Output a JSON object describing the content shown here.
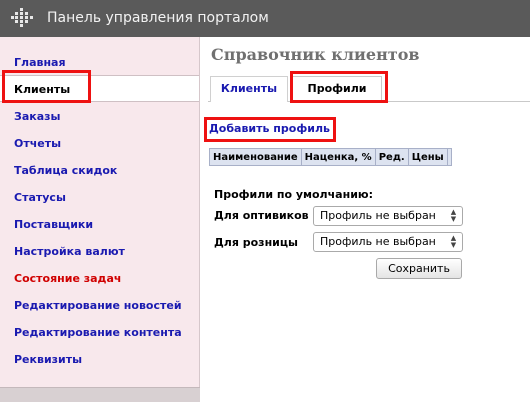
{
  "header": {
    "title": "Панель управления порталом"
  },
  "sidebar": {
    "items": [
      {
        "label": "Главная"
      },
      {
        "label": "Клиенты"
      },
      {
        "label": "Заказы"
      },
      {
        "label": "Отчеты"
      },
      {
        "label": "Таблица скидок"
      },
      {
        "label": "Статусы"
      },
      {
        "label": "Поставщики"
      },
      {
        "label": "Настройка валют"
      },
      {
        "label": "Состояние задач"
      },
      {
        "label": "Редактирование новостей"
      },
      {
        "label": "Редактирование контента"
      },
      {
        "label": "Реквизиты"
      }
    ],
    "active_item": "Клиенты"
  },
  "main": {
    "title": "Справочник клиентов",
    "tabs": [
      {
        "label": "Клиенты"
      },
      {
        "label": "Профили"
      }
    ],
    "active_tab": "Профили",
    "add_profile_link": "Добавить профиль",
    "table": {
      "columns": [
        "Наименование",
        "Наценка, %",
        "Ред.",
        "Цены"
      ]
    },
    "defaults": {
      "title": "Профили по умолчанию:",
      "wholesale_label": "Для оптивиков",
      "wholesale_value": "Профиль не выбран",
      "retail_label": "Для розницы",
      "retail_value": "Профиль не выбран"
    },
    "save_label": "Сохранить"
  },
  "colors": {
    "link": "#1a1ab0",
    "highlight": "#ee1111",
    "sidebar_bg": "#f8e8ec",
    "header_bg": "#5a5a5a",
    "alert_text": "#d00000"
  },
  "icons": {
    "logo": "dots-grid-icon",
    "select_arrows": "updown-arrows-icon"
  }
}
